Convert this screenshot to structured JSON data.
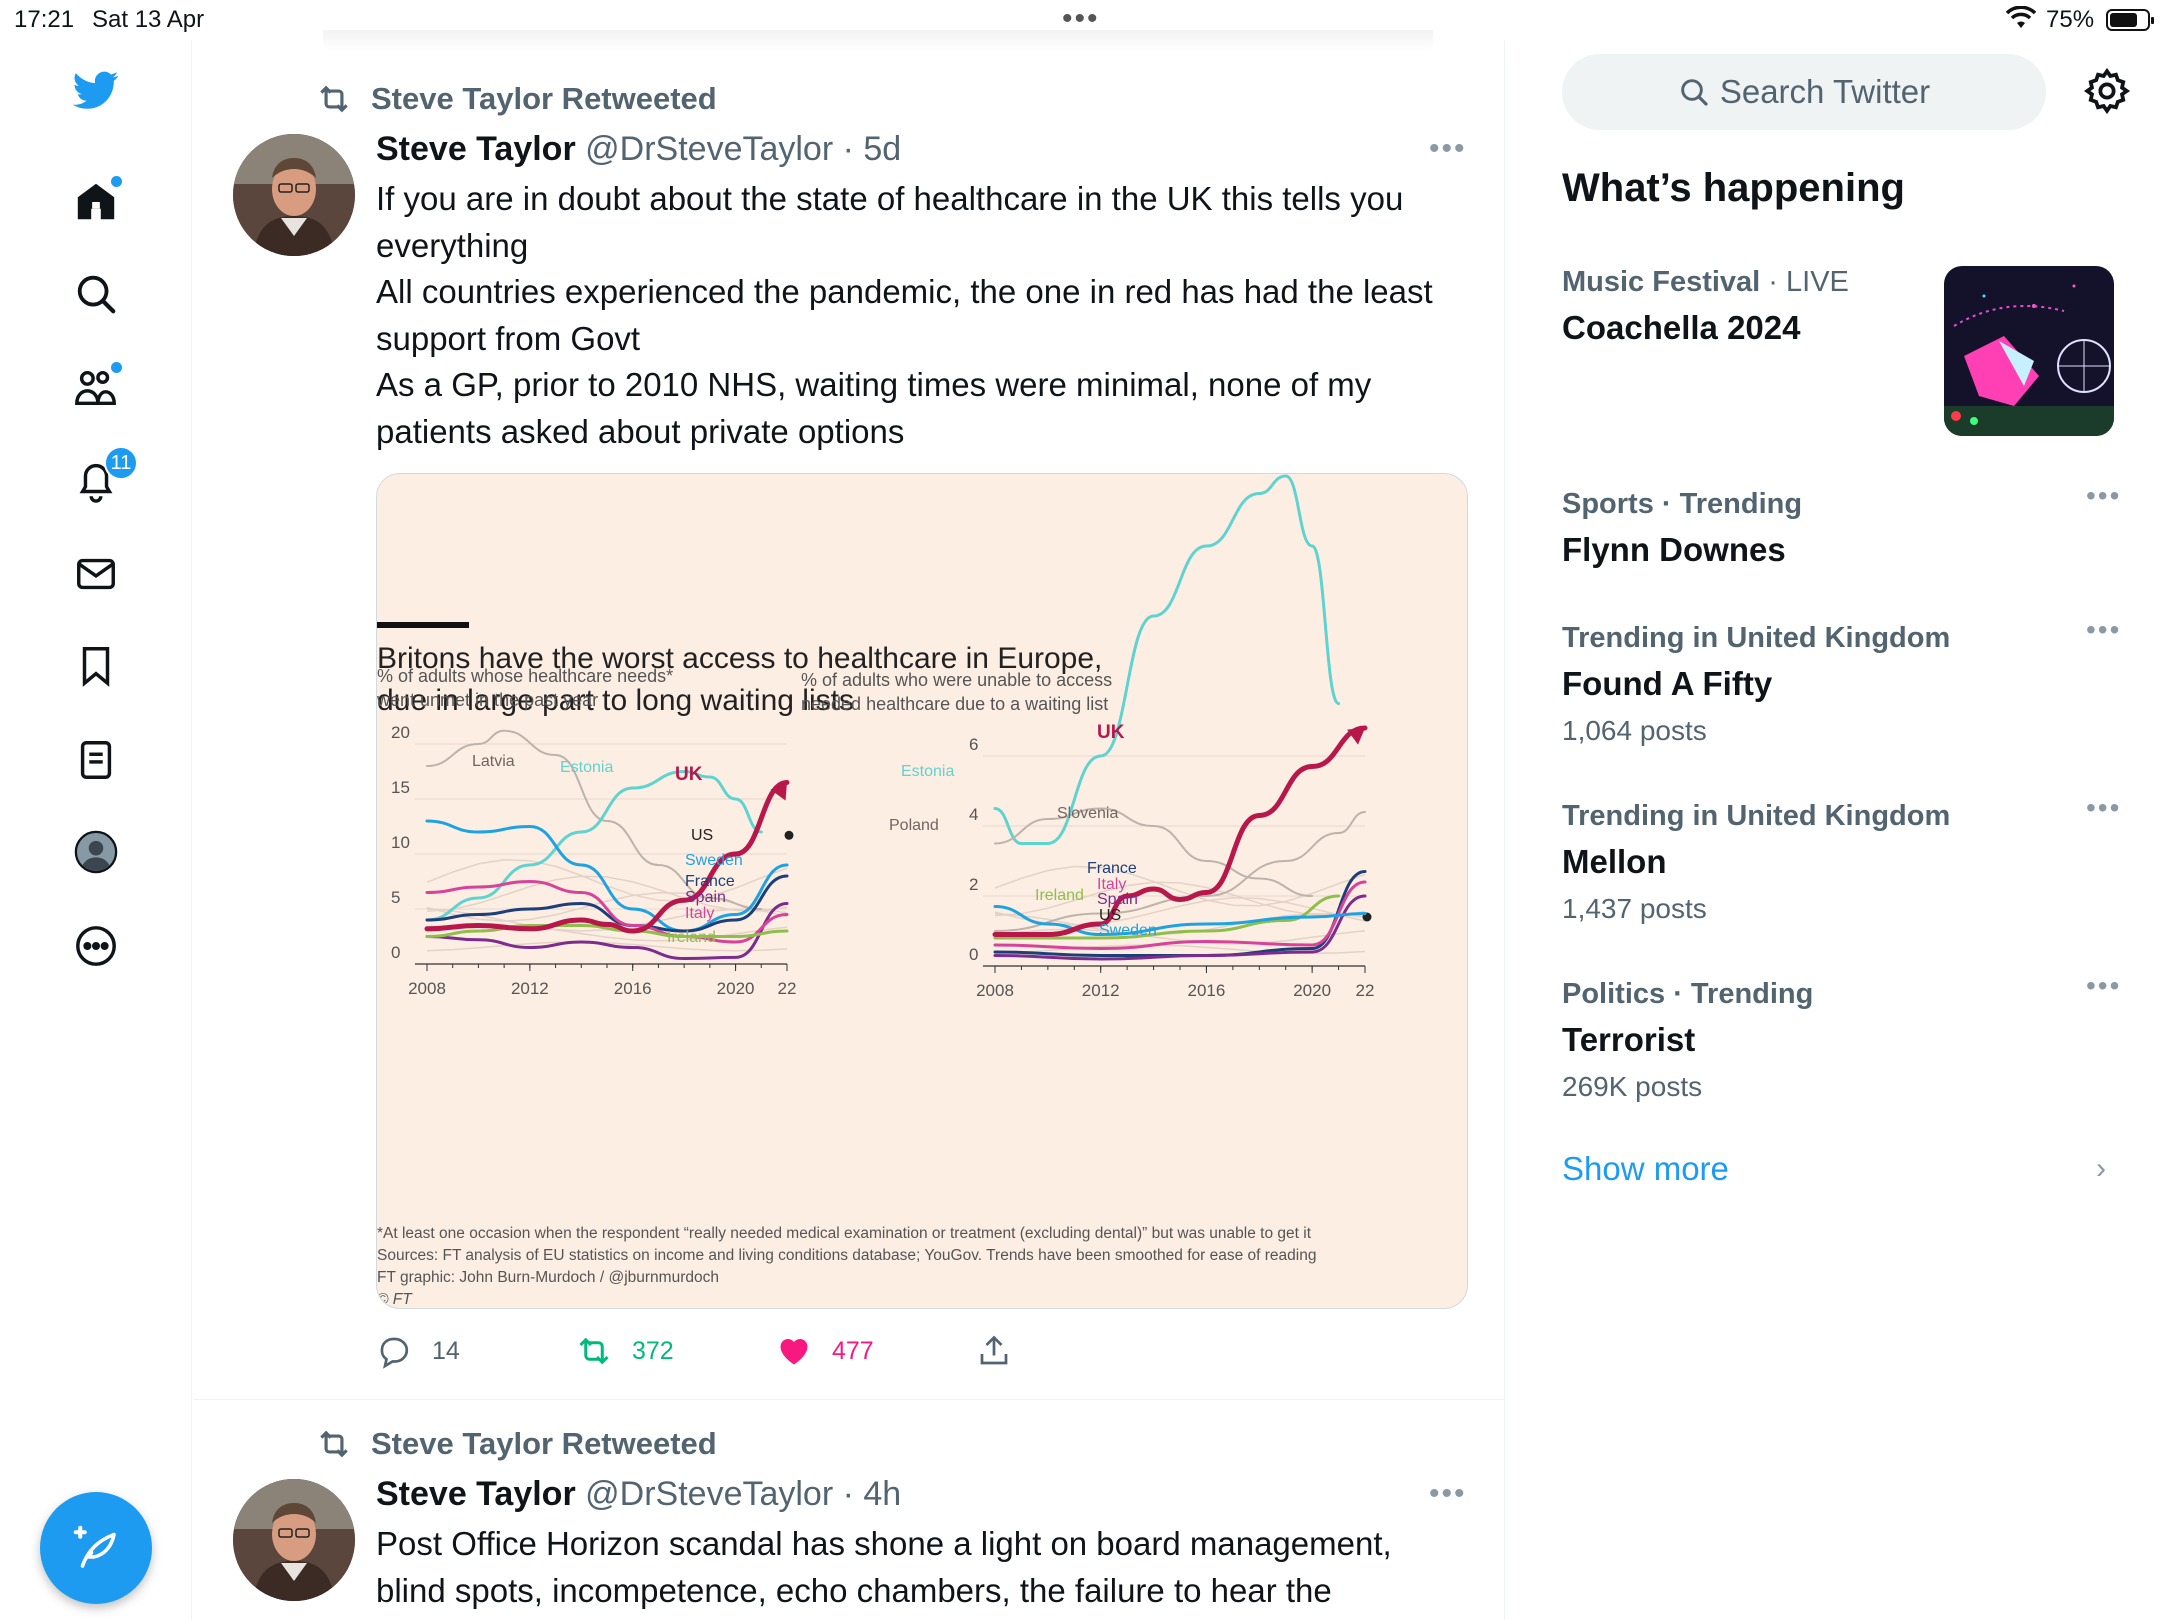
{
  "status_bar": {
    "time": "17:21",
    "date": "Sat 13 Apr",
    "battery": "75%",
    "battery_level": 0.75
  },
  "nav": {
    "notifications_count": "11",
    "icons": [
      "twitter-logo",
      "home-icon",
      "search-icon",
      "communities-icon",
      "notifications-icon",
      "messages-icon",
      "bookmarks-icon",
      "lists-icon",
      "profile-icon",
      "more-icon",
      "compose-icon"
    ]
  },
  "tweets": [
    {
      "retweet_label": "Steve Taylor Retweeted",
      "name": "Steve Taylor",
      "handle": "@DrSteveTaylor",
      "time": "· 5d",
      "text": [
        "If you are in doubt about the state of healthcare in the UK this tells you everything",
        "All countries experienced the pandemic, the one in red has had the least support from Govt",
        "As a GP, prior to 2010 NHS, waiting times were minimal, none of my patients asked about private options"
      ],
      "actions": {
        "replies": "14",
        "retweets": "372",
        "likes": "477"
      }
    },
    {
      "retweet_label": "Steve Taylor Retweeted",
      "name": "Steve Taylor",
      "handle": "@DrSteveTaylor",
      "time": "· 4h",
      "text": [
        "Post Office Horizon scandal has shone a light on board management, blind spots, incompetence, echo chambers, the failure to hear the"
      ]
    }
  ],
  "chart_data": {
    "type": "line",
    "title": "Britons have the worst access to healthcare in Europe, due in large part to long waiting lists",
    "footnote": "*At least one occasion when the respondent “really needed medical examination or treatment (excluding dental)” but was unable to get it",
    "sources": "Sources: FT analysis of EU statistics on income and living conditions database; YouGov. Trends have been smoothed for ease of reading",
    "credit": "FT graphic: John Burn-Murdoch / @jburnmurdoch",
    "copyright": "© FT",
    "colors": {
      "UK": "#b8174a",
      "Estonia": "#5fd3cf",
      "Sweden": "#1fa2e0",
      "France": "#1c3f7a",
      "Spain": "#7d2b8c",
      "Italy": "#d6449a",
      "Ireland": "#8fbf4a",
      "US": "#222222",
      "background": "#fdeee4"
    },
    "charts": [
      {
        "subtitle": "% of adults whose healthcare needs* went unmet in the past year",
        "x_ticks": [
          "2008",
          "2012",
          "2016",
          "2020",
          "22"
        ],
        "y_ticks": [
          "0",
          "5",
          "10",
          "15",
          "20"
        ],
        "ylim": [
          0,
          20
        ],
        "xlim": [
          2008,
          2022
        ],
        "series": [
          {
            "name": "Latvia",
            "x": [
              2008,
              2010,
              2011,
              2013,
              2015,
              2017,
              2019,
              2021
            ],
            "y": [
              18,
              20,
              21.2,
              19,
              13,
              9,
              6,
              5
            ]
          },
          {
            "name": "Estonia",
            "x": [
              2008,
              2010,
              2012,
              2014,
              2016,
              2018,
              2019,
              2020,
              2021
            ],
            "y": [
              4,
              6,
              9,
              12,
              16,
              17.5,
              17,
              15,
              12
            ]
          },
          {
            "name": "UK",
            "x": [
              2008,
              2010,
              2012,
              2014,
              2015,
              2016,
              2018,
              2020,
              2022
            ],
            "y": [
              3.2,
              3.5,
              3.2,
              4,
              3.6,
              3,
              5.8,
              10,
              16.5
            ]
          },
          {
            "name": "US",
            "x": [
              2022
            ],
            "y": [
              11.7
            ]
          },
          {
            "name": "Sweden",
            "x": [
              2008,
              2010,
              2012,
              2014,
              2016,
              2018,
              2020,
              2022
            ],
            "y": [
              13,
              12,
              12.5,
              9,
              5,
              3,
              4.5,
              9
            ]
          },
          {
            "name": "France",
            "x": [
              2008,
              2010,
              2012,
              2014,
              2016,
              2018,
              2020,
              2022
            ],
            "y": [
              4,
              4.5,
              5,
              5.5,
              3.5,
              3,
              4,
              8
            ]
          },
          {
            "name": "Spain",
            "x": [
              2008,
              2010,
              2012,
              2014,
              2016,
              2018,
              2020,
              2022
            ],
            "y": [
              2.5,
              2.2,
              1.5,
              2,
              1.5,
              0.5,
              0.6,
              5.5
            ]
          },
          {
            "name": "Italy",
            "x": [
              2008,
              2010,
              2012,
              2014,
              2016,
              2018,
              2020,
              2022
            ],
            "y": [
              6.5,
              7,
              7.5,
              6.5,
              3.5,
              2.5,
              2,
              4.5
            ]
          },
          {
            "name": "Ireland",
            "x": [
              2008,
              2010,
              2012,
              2014,
              2016,
              2018,
              2020,
              2022
            ],
            "y": [
              2.5,
              3,
              3.5,
              3.5,
              3,
              2.5,
              2.5,
              3
            ]
          }
        ]
      },
      {
        "subtitle": "% of adults who were unable to access needed healthcare due to a waiting list",
        "x_ticks": [
          "2008",
          "2012",
          "2016",
          "2020",
          "22"
        ],
        "y_ticks": [
          "0",
          "2",
          "4",
          "6"
        ],
        "ylim": [
          0,
          6
        ],
        "xlim": [
          2008,
          2022
        ],
        "series": [
          {
            "name": "Estonia",
            "x": [
              2008,
              2009,
              2010,
              2012,
              2014,
              2016,
              2018,
              2019,
              2020,
              2021
            ],
            "y": [
              4.5,
              3.5,
              3.5,
              6,
              10,
              12,
              13.5,
              14,
              12,
              7.5
            ]
          },
          {
            "name": "Poland",
            "x": [
              2008,
              2010,
              2012,
              2014,
              2016,
              2018,
              2020
            ],
            "y": [
              3.5,
              4.2,
              4.5,
              4,
              3,
              2.5,
              2
            ]
          },
          {
            "name": "Slovenia",
            "x": [
              2008,
              2012,
              2016,
              2019,
              2021,
              2022
            ],
            "y": [
              1,
              1.5,
              2,
              3,
              3.8,
              4.4
            ]
          },
          {
            "name": "UK",
            "x": [
              2008,
              2010,
              2012,
              2013,
              2014,
              2015,
              2016,
              2018,
              2020,
              2022
            ],
            "y": [
              0.9,
              0.9,
              1.2,
              2,
              2.2,
              1.9,
              2.1,
              4.3,
              5.7,
              6.8
            ]
          },
          {
            "name": "France",
            "x": [
              2008,
              2012,
              2016,
              2020,
              2022
            ],
            "y": [
              0.4,
              0.3,
              0.3,
              0.5,
              2.7
            ]
          },
          {
            "name": "Italy",
            "x": [
              2008,
              2012,
              2016,
              2020,
              2022
            ],
            "y": [
              0.6,
              0.5,
              0.7,
              0.6,
              2.4
            ]
          },
          {
            "name": "Spain",
            "x": [
              2008,
              2012,
              2016,
              2020,
              2022
            ],
            "y": [
              0.3,
              0.2,
              0.3,
              0.4,
              2
            ]
          },
          {
            "name": "Ireland",
            "x": [
              2008,
              2012,
              2016,
              2019,
              2021
            ],
            "y": [
              0.8,
              0.8,
              1,
              1.3,
              2
            ]
          },
          {
            "name": "US",
            "x": [
              2022
            ],
            "y": [
              1.4
            ]
          },
          {
            "name": "Sweden",
            "x": [
              2008,
              2010,
              2012,
              2016,
              2020,
              2022
            ],
            "y": [
              1.7,
              1.2,
              0.9,
              1.2,
              1.4,
              1.5
            ]
          }
        ]
      }
    ]
  },
  "right": {
    "search_placeholder": "Search Twitter",
    "section_title": "What’s happening",
    "trends": [
      {
        "category": "Music Festival",
        "context": " · LIVE",
        "name": "Coachella 2024",
        "count": ""
      },
      {
        "category": "Sports · Trending",
        "context": "",
        "name": "Flynn Downes",
        "count": ""
      },
      {
        "category": "Trending in United Kingdom",
        "context": "",
        "name": "Found A Fifty",
        "count": "1,064 posts"
      },
      {
        "category": "Trending in United Kingdom",
        "context": "",
        "name": "Mellon",
        "count": "1,437 posts"
      },
      {
        "category": "Politics · Trending",
        "context": "",
        "name": "Terrorist",
        "count": "269K posts"
      }
    ],
    "show_more": "Show more"
  }
}
